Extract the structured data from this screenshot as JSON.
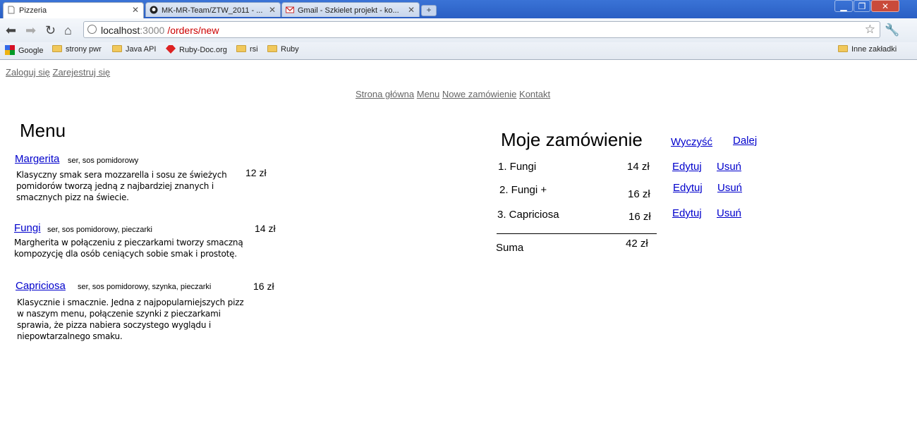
{
  "browser": {
    "tabs": [
      {
        "title": "Pizzeria",
        "active": true
      },
      {
        "title": "MK-MR-Team/ZTW_2011 - ...",
        "active": false
      },
      {
        "title": "Gmail - Szkielet projekt - ko...",
        "active": false
      }
    ],
    "url": {
      "host": "localhost",
      "port": ":3000",
      "path": "/orders/new"
    },
    "bookmarks": [
      "Google",
      "strony pwr",
      "Java API",
      "Ruby-Doc.org",
      "rsi",
      "Ruby"
    ],
    "other_bookmarks": "Inne zakładki"
  },
  "auth": {
    "login": "Zaloguj się",
    "register": "Zarejestruj się"
  },
  "nav": {
    "home": "Strona główna",
    "menu": "Menu",
    "new_order": "Nowe zamówienie",
    "contact": "Kontakt"
  },
  "menu": {
    "title": "Menu",
    "pizzas": [
      {
        "name": "Margerita",
        "ingredients": "ser, sos pomidorowy",
        "description": "Klasyczny smak sera mozzarella i sosu ze świeżych pomidorów tworzą jedną z najbardziej znanych i smacznych pizz na świecie.",
        "price": "12 zł"
      },
      {
        "name": "Fungi",
        "ingredients": "ser, sos pomidorowy, pieczarki",
        "description": "Margherita w połączeniu z pieczarkami tworzy smaczną kompozycję dla osób ceniących sobie smak i prostotę.",
        "price": "14 zł"
      },
      {
        "name": "Capriciosa",
        "ingredients": "ser, sos pomidorowy, szynka, pieczarki",
        "description": "Klasycznie i smacznie. Jedna z najpopularniejszych pizz w naszym menu, połączenie szynki z pieczarkami sprawia, że pizza nabiera soczystego wyglądu i niepowtarzalnego smaku.",
        "price": "16 zł"
      }
    ]
  },
  "order": {
    "title": "Moje zamówienie",
    "clear": "Wyczyść",
    "next": "Dalej",
    "items": [
      {
        "label": "1. Fungi",
        "price": "14 zł",
        "edit": "Edytuj",
        "remove": "Usuń"
      },
      {
        "label": "2. Fungi +",
        "price": "16 zł",
        "edit": "Edytuj",
        "remove": "Usuń"
      },
      {
        "label": "3. Capriciosa",
        "price": "16 zł",
        "edit": "Edytuj",
        "remove": "Usuń"
      }
    ],
    "sum_label": "Suma",
    "sum_value": "42 zł"
  }
}
